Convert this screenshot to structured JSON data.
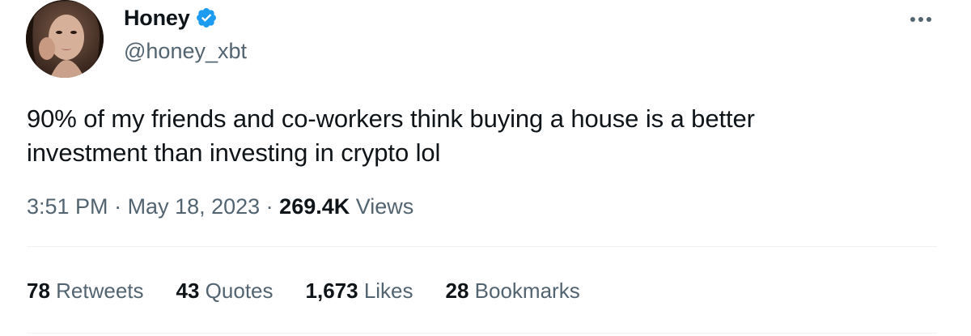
{
  "author": {
    "display_name": "Honey",
    "handle": "@honey_xbt",
    "verified_icon": "verified-badge-icon",
    "verified_color": "#1d9bf0"
  },
  "tweet": {
    "text_line1": "90% of my friends and co-workers think buying a house is a better",
    "text_line2": "investment than investing in crypto lol"
  },
  "meta": {
    "time": "3:51 PM",
    "sep1": " · ",
    "date": "May 18, 2023",
    "sep2": " · ",
    "views_count": "269.4K",
    "views_label": " Views"
  },
  "stats": {
    "retweets": {
      "count": "78",
      "label": " Retweets"
    },
    "quotes": {
      "count": "43",
      "label": " Quotes"
    },
    "likes": {
      "count": "1,673",
      "label": " Likes"
    },
    "bookmarks": {
      "count": "28",
      "label": " Bookmarks"
    }
  },
  "colors": {
    "text_primary": "#0f1419",
    "text_secondary": "#536471",
    "divider": "#eff3f4"
  }
}
